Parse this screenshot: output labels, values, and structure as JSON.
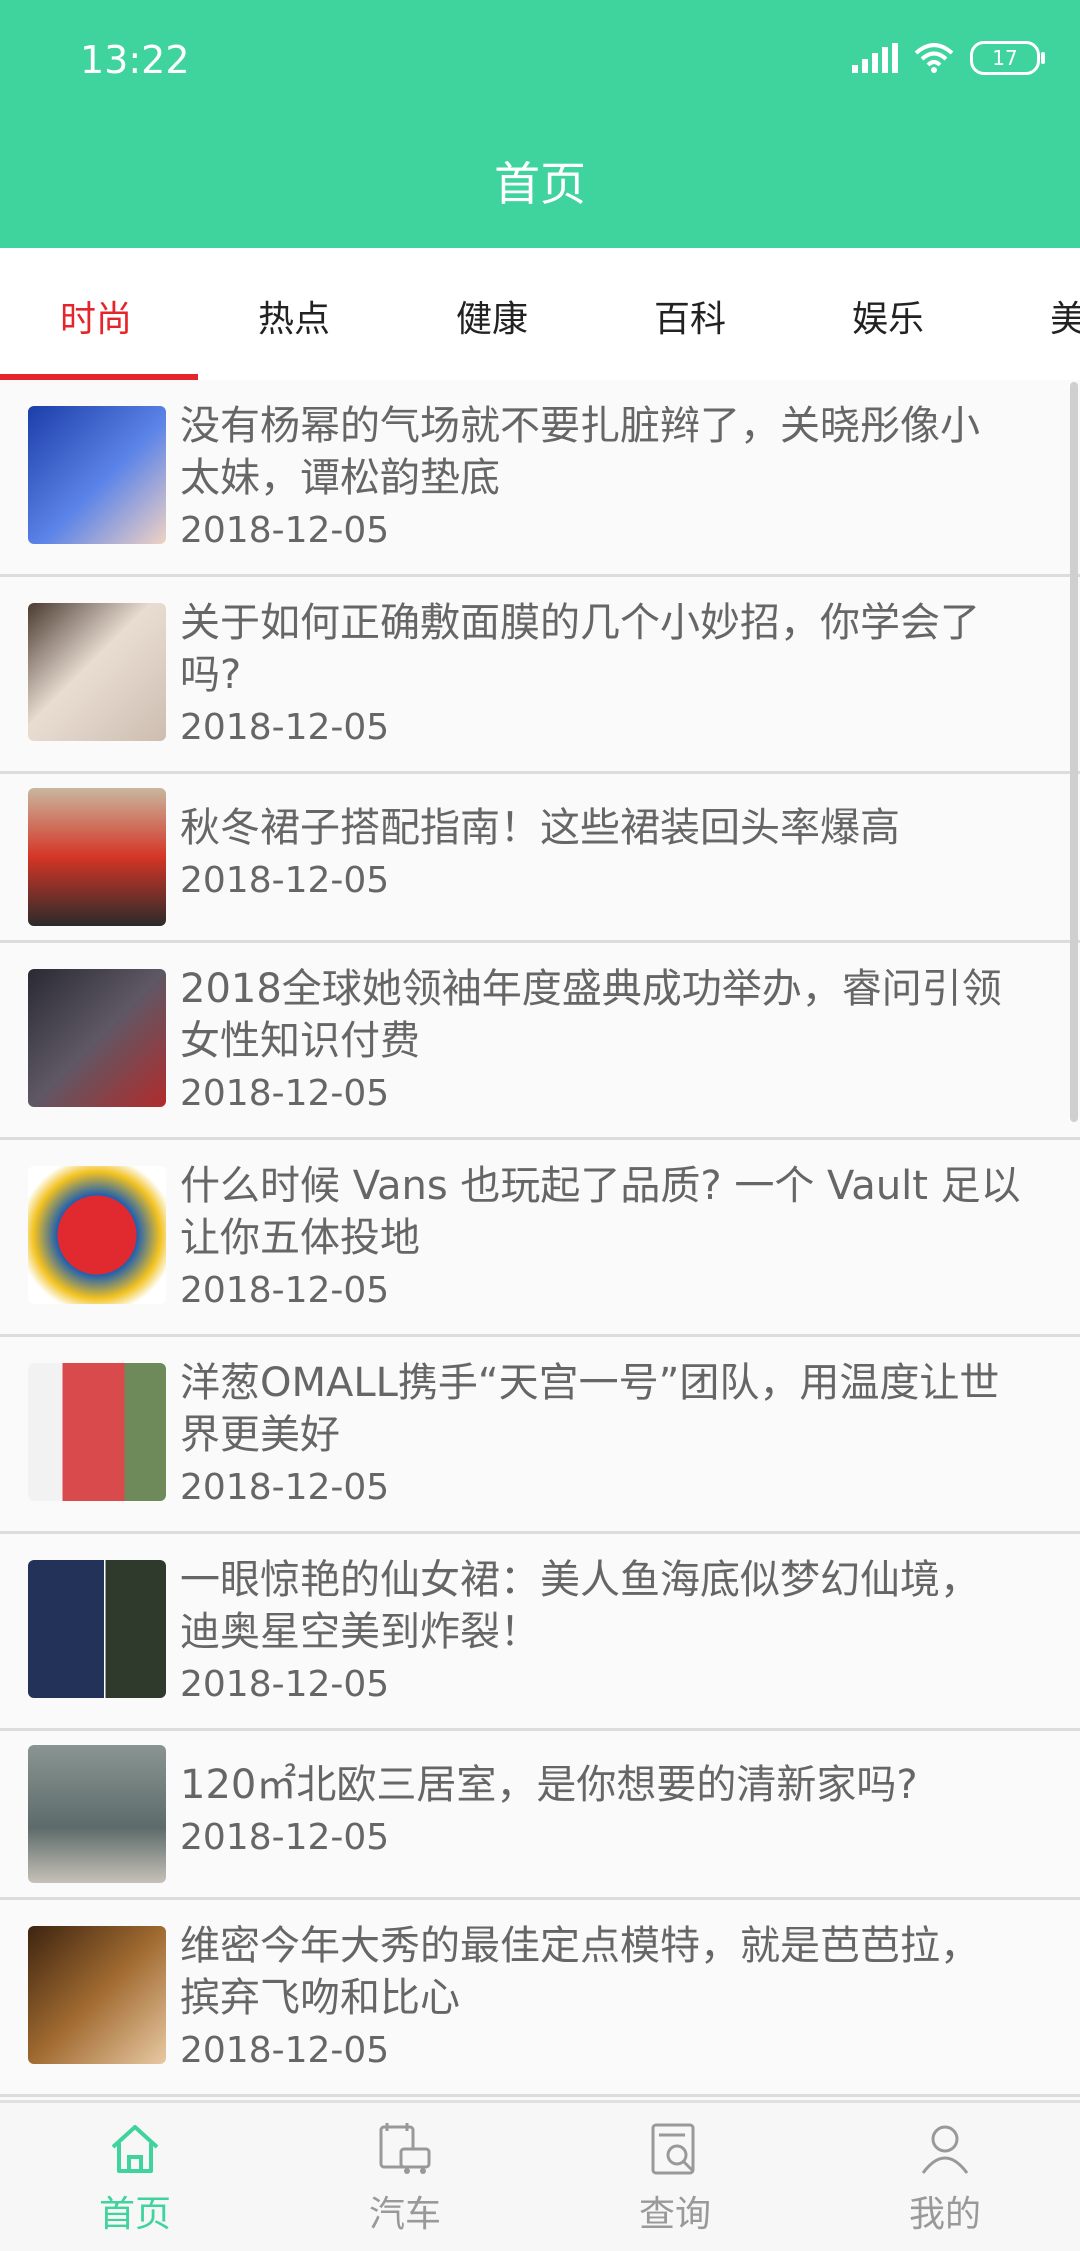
{
  "status": {
    "time": "13:22",
    "battery": "17"
  },
  "header": {
    "title": "首页"
  },
  "tabs": [
    {
      "label": "时尚",
      "active": true
    },
    {
      "label": "热点"
    },
    {
      "label": "健康"
    },
    {
      "label": "百科"
    },
    {
      "label": "娱乐"
    },
    {
      "label": "美"
    }
  ],
  "articles": [
    {
      "title_line1": "没有杨幂的气场就不要扎脏辫了，关晓彤像小",
      "title_line2": "太妹，谭松韵垫底",
      "date": "2018-12-05",
      "thumb_color": "#2a56c8"
    },
    {
      "title_line1": "关于如何正确敷面膜的几个小妙招，你学会了",
      "title_line2": "吗?",
      "date": "2018-12-05",
      "thumb_color": "#d8c9bd"
    },
    {
      "title_line1": "秋冬裙子搭配指南！这些裙装回头率爆高",
      "title_line2": "",
      "date": "2018-12-05",
      "thumb_color": "#c73a2f"
    },
    {
      "title_line1": "2018全球她领袖年度盛典成功举办，睿问引领",
      "title_line2": "女性知识付费",
      "date": "2018-12-05",
      "thumb_color": "#3a3840"
    },
    {
      "title_line1": "什么时候 Vans 也玩起了品质? 一个 Vault 足以",
      "title_line2": "让你五体投地",
      "date": "2018-12-05",
      "thumb_color": "#d7262c"
    },
    {
      "title_line1": "洋葱OMALL携手“天宫一号”团队，用温度让世",
      "title_line2": "界更美好",
      "date": "2018-12-05",
      "thumb_color": "#d54b4e"
    },
    {
      "title_line1": "一眼惊艳的仙女裙：美人鱼海底似梦幻仙境，",
      "title_line2": "迪奥星空美到炸裂！",
      "date": "2018-12-05",
      "thumb_color": "#2f3c64"
    },
    {
      "title_line1": "120㎡北欧三居室，是你想要的清新家吗?",
      "title_line2": "",
      "date": "2018-12-05",
      "thumb_color": "#6f7d7b"
    },
    {
      "title_line1": "维密今年大秀的最佳定点模特，就是芭芭拉，",
      "title_line2": "摈弃飞吻和比心",
      "date": "2018-12-05",
      "thumb_color": "#6e4a20"
    }
  ],
  "bottom_nav": [
    {
      "label": "首页",
      "icon": "home-icon",
      "active": true
    },
    {
      "label": "汽车",
      "icon": "car-icon"
    },
    {
      "label": "查询",
      "icon": "search-doc-icon"
    },
    {
      "label": "我的",
      "icon": "user-icon"
    }
  ],
  "colors": {
    "brand": "#3fd39d",
    "accent": "#e5252c"
  }
}
